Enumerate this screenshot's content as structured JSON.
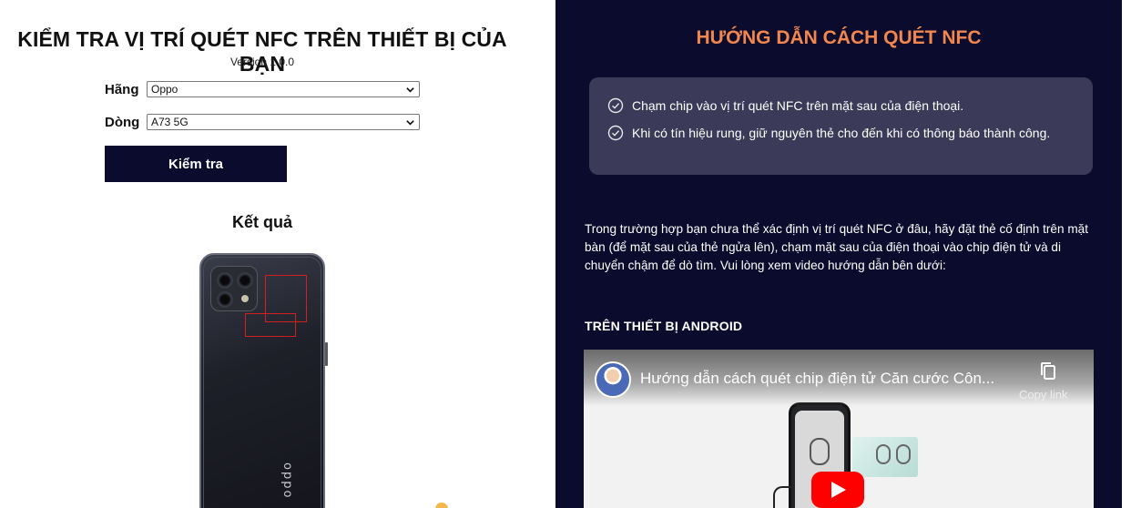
{
  "left": {
    "title": "KIỂM TRA VỊ TRÍ QUÉT NFC TRÊN THIẾT BỊ CỦA BẠN",
    "version": "Version 1.0.0",
    "form": {
      "brand_label": "Hãng",
      "brand_value": "Oppo",
      "model_label": "Dòng",
      "model_value": "A73 5G",
      "check_button": "Kiểm tra"
    },
    "result_title": "Kết quả",
    "phone_brand_text": "oppo"
  },
  "right": {
    "title": "HƯỚNG DẪN CÁCH QUÉT NFC",
    "title_color": "#f2874d",
    "background_color": "#0b0b2e",
    "steps": [
      "Chạm chip vào vị trí quét NFC trên mặt sau của điện thoại.",
      "Khi có tín hiệu rung, giữ nguyên thẻ cho đến khi có thông báo thành công."
    ],
    "paragraph": "Trong trường hợp bạn chưa thể xác định vị trí quét NFC ở đâu, hãy đặt thẻ cố định trên mặt bàn (để mặt sau của thẻ ngửa lên), chạm mặt sau của điện thoại vào chip điện tử và di chuyển chậm để dò tìm. Vui lòng xem video hướng dẫn bên dưới:",
    "android_label": "TRÊN THIẾT BỊ ANDROID",
    "video": {
      "title": "Hướng dẫn cách quét chip điện tử Căn cước Côn...",
      "copy_label": "Copy link"
    }
  }
}
